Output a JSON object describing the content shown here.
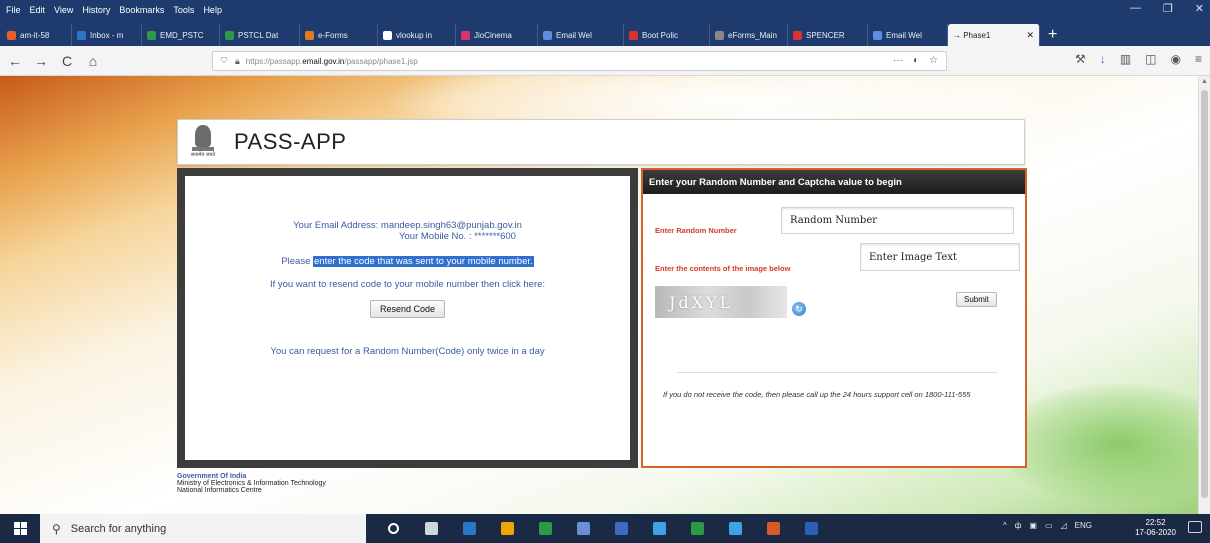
{
  "menubar": {
    "items": [
      "File",
      "Edit",
      "View",
      "History",
      "Bookmarks",
      "Tools",
      "Help"
    ],
    "minimize": "—",
    "restore": "❐",
    "close": "✕"
  },
  "tabs": [
    {
      "label": "am-it-58",
      "color": "#e35d2f"
    },
    {
      "label": "Inbox - m",
      "color": "#2b76c9"
    },
    {
      "label": "EMD_PSTC",
      "color": "#2e9a47"
    },
    {
      "label": "PSTCL Dat",
      "color": "#2e9a47"
    },
    {
      "label": "e-Forms",
      "color": "#e07b24"
    },
    {
      "label": "vlookup in",
      "color": "#ffffff"
    },
    {
      "label": "JioCinema",
      "color": "#d8336c"
    },
    {
      "label": "Email Wel",
      "color": "#5c8de0"
    },
    {
      "label": "Boot Polic",
      "color": "#d8332f"
    },
    {
      "label": "eForms_Main",
      "color": "#888888"
    },
    {
      "label": "SPENCER",
      "color": "#d8332f"
    },
    {
      "label": "Email Wel",
      "color": "#5c8de0"
    },
    {
      "label": "→ Phase1",
      "color": "#f4f4f4",
      "active": true
    }
  ],
  "tab_close": "✕",
  "new_tab": "+",
  "navbar": {
    "back": "←",
    "forward": "→",
    "reload": "C",
    "home": "⌂",
    "url_prefix": "https://passapp.",
    "url_domain": "email.gov.in",
    "url_suffix": "/passapp/phase1.jsp",
    "url_more": "···",
    "pocket": "◐",
    "star": "☆",
    "tools": [
      "⚒",
      "↓",
      "▥",
      "◫",
      "◉",
      "≡"
    ]
  },
  "header": {
    "title": "PASS-APP",
    "emblem_motto": "सत्यमेव जयते"
  },
  "left": {
    "email_line": "Your Email Address: mandeep.singh63@punjab.gov.in",
    "mobile_line": "Your Mobile No. : *******600",
    "please": "Please ",
    "please_hl": "enter the code that was sent to your mobile number.",
    "resend_line": "If you want to resend code to your mobile number then click here:",
    "resend_button": "Resend Code",
    "limit_line": "You can request for a Random Number(Code) only twice in a day"
  },
  "right": {
    "heading": "Enter your Random Number and Captcha value to begin",
    "random_label": "Enter Random Number",
    "random_value": "Random Number",
    "image_label": "Enter the contents of the image below",
    "image_value": "Enter Image Text",
    "captcha_text": "JdXYL",
    "refresh": "↻",
    "submit": "Submit",
    "support": "If you do not receive the code, then please call up the 24 hours support cell on 1800-111-555"
  },
  "footer": {
    "line1": "Government Of India",
    "line2": "Ministry of Electronics & Information Technology",
    "line3": "National Informatics Centre"
  },
  "scroll_up": "▲",
  "taskbar": {
    "search_placeholder": "Search for anything",
    "search_icon": "⚲",
    "icons": [
      {
        "color": "#ffffff",
        "name": "cortana"
      },
      {
        "color": "#cfd6e2",
        "name": "task-view"
      },
      {
        "color": "#2b76c9",
        "name": "outlook"
      },
      {
        "color": "#f0a500",
        "name": "file-explorer"
      },
      {
        "color": "#2e9a47",
        "name": "excel"
      },
      {
        "color": "#6a8fd6",
        "name": "app"
      },
      {
        "color": "#3d6bc4",
        "name": "app2"
      },
      {
        "color": "#3fa1e6",
        "name": "teams"
      },
      {
        "color": "#2e9a47",
        "name": "excel2"
      },
      {
        "color": "#3fa1e6",
        "name": "edge"
      },
      {
        "color": "#d85a2a",
        "name": "powerpoint"
      },
      {
        "color": "#2b5fb3",
        "name": "word"
      }
    ],
    "tray": [
      "^",
      "ф",
      "▣",
      "▭",
      "◿",
      "ENG"
    ],
    "time": "22:52",
    "date": "17-06-2020"
  }
}
